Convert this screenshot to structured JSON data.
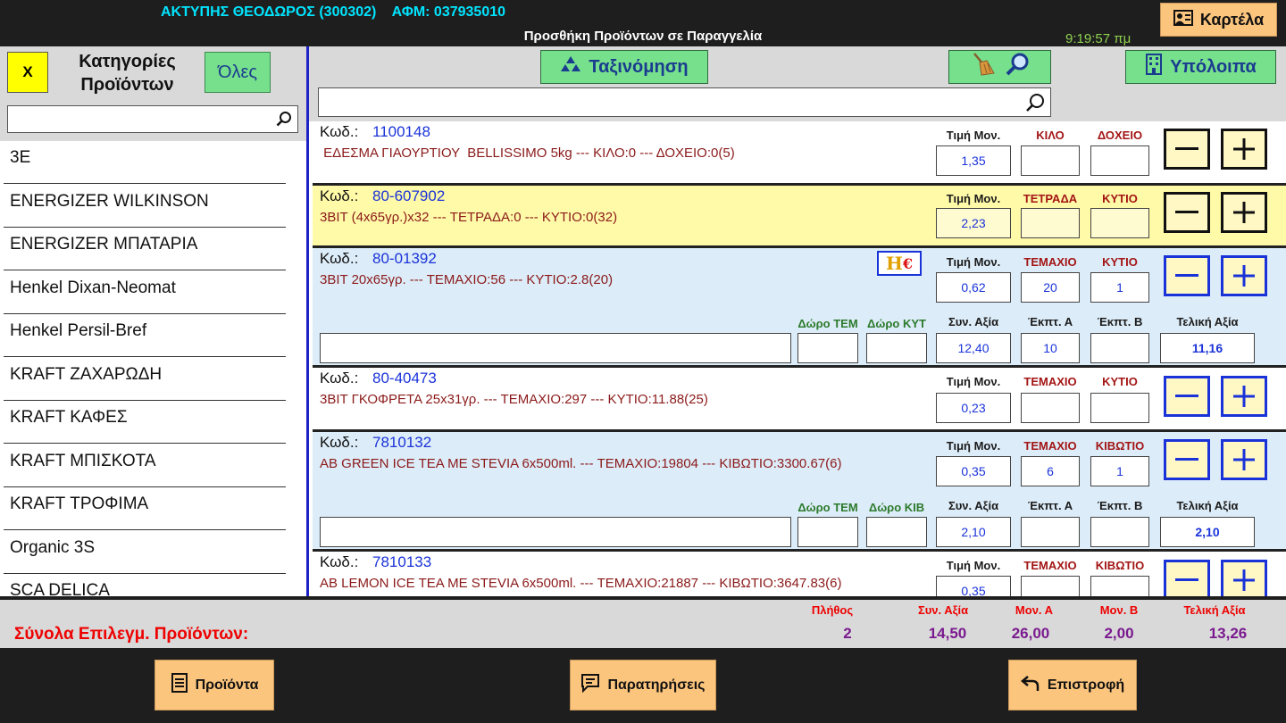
{
  "header": {
    "customer": "ΑΚΤΥΠΗΣ ΘΕΟΔΩΡΟΣ (300302)    ΑΦΜ: 037935010",
    "title": "Προσθήκη Προϊόντων σε Παραγγελία",
    "clock": "9:19:57 πμ",
    "kartela_label": "Καρτέλα"
  },
  "categories": {
    "x_label": "X",
    "title_line1": "Κατηγορίες",
    "title_line2": "Προϊόντων",
    "all_label": "Όλες",
    "search_value": "",
    "items": [
      "3E",
      "ENERGIZER WILKINSON",
      "ENERGIZER ΜΠΑΤΑΡΙΑ",
      "Henkel Dixan-Neomat",
      "Henkel Persil-Bref",
      "KRAFT ΖΑΧΑΡΩΔΗ",
      "KRAFT ΚΑΦΕΣ",
      "KRAFT ΜΠΙΣΚΟΤΑ",
      "KRAFT ΤΡΟΦΙΜΑ",
      "Organic 3S",
      "SCA DELICA"
    ]
  },
  "toolbar": {
    "sort_label": "Ταξινόμηση",
    "balance_label": "Υπόλοιπα",
    "search_value": ""
  },
  "code_label": "Κωδ.:",
  "labels": {
    "unit_price": "Τιμή Μον.",
    "gift_tem": "Δώρο ΤΕΜ",
    "gift_kyt": "Δώρο ΚΥΤ",
    "gift_kib": "Δώρο ΚΙΒ",
    "total_value": "Συν. Αξία",
    "disc_a": "Έκπτ. Α",
    "disc_b": "Έκπτ. Β",
    "final_value": "Τελική Αξία"
  },
  "products": [
    {
      "code": "1100148",
      "desc": " ΕΔΕΣΜΑ ΓΙΑΟΥΡΤΙΟΥ  BELLISSIMO 5kg --- ΚΙΛΟ:0 --- ΔΟΧΕΙΟ:0(5)",
      "unit1": "ΚΙΛΟ",
      "unit2": "ΔΟΧΕΙΟ",
      "price": "1,35",
      "q1": "",
      "q2": ""
    },
    {
      "code": "80-607902",
      "desc": "3ΒΙΤ (4x65γρ.)x32 --- ΤΕΤΡΑΔΑ:0 --- ΚΥΤΙΟ:0(32)",
      "unit1": "ΤΕΤΡΑΔΑ",
      "unit2": "ΚΥΤΙΟ",
      "price": "2,23",
      "q1": "",
      "q2": ""
    },
    {
      "code": "80-01392",
      "desc": "3ΒΙΤ 20x65γρ. --- ΤΕΜΑΧΙΟ:56 --- ΚΥΤΙΟ:2.8(20)",
      "unit1": "ΤΕΜΑΧΙΟ",
      "unit2": "ΚΥΤΙΟ",
      "price": "0,62",
      "q1": "20",
      "q2": "1",
      "badge_h": "H",
      "badge_e": "€",
      "note": "",
      "gift1": "",
      "gift2": "",
      "total": "12,40",
      "disc_a": "10",
      "disc_b": "",
      "final": "11,16"
    },
    {
      "code": "80-40473",
      "desc": "3ΒΙΤ ΓΚΟΦΡΕΤΑ 25x31γρ. --- ΤΕΜΑΧΙΟ:297 --- ΚΥΤΙΟ:11.88(25)",
      "unit1": "ΤΕΜΑΧΙΟ",
      "unit2": "ΚΥΤΙΟ",
      "price": "0,23",
      "q1": "",
      "q2": ""
    },
    {
      "code": "7810132",
      "desc": "AB GREEN ICE TEA ME STEVIA 6x500ml. --- ΤΕΜΑΧΙΟ:19804 --- ΚΙΒΩΤΙΟ:3300.67(6)",
      "unit1": "ΤΕΜΑΧΙΟ",
      "unit2": "ΚΙΒΩΤΙΟ",
      "price": "0,35",
      "q1": "6",
      "q2": "1",
      "note": "",
      "gift1": "",
      "gift2": "",
      "total": "2,10",
      "disc_a": "",
      "disc_b": "",
      "final": "2,10"
    },
    {
      "code": "7810133",
      "desc": "AB LEMON ICE TEA ME STEVIA 6x500ml. --- ΤΕΜΑΧΙΟ:21887 --- ΚΙΒΩΤΙΟ:3647.83(6)",
      "unit1": "ΤΕΜΑΧΙΟ",
      "unit2": "ΚΙΒΩΤΙΟ",
      "price": "0,35",
      "q1": "",
      "q2": ""
    }
  ],
  "totals": {
    "title": "Σύνολα Επιλεγμ. Προϊόντων:",
    "count_label": "Πλήθος",
    "count": "2",
    "total_label": "Συν. Αξία",
    "total": "14,50",
    "mon_a_label": "Μον. Α",
    "mon_a": "26,00",
    "mon_b_label": "Μον. Β",
    "mon_b": "2,00",
    "final_label": "Τελική Αξία",
    "final": "13,26"
  },
  "bottom": {
    "products_label": "Προϊόντα",
    "notes_label": "Παρατηρήσεις",
    "back_label": "Επιστροφή"
  },
  "colors": {
    "accent_green": "#77e08d",
    "accent_orange": "#fcc57e",
    "highlight_yellow": "#fffaa8",
    "selected_blue": "#dcecf8",
    "divider_blue": "#1f22c9"
  }
}
